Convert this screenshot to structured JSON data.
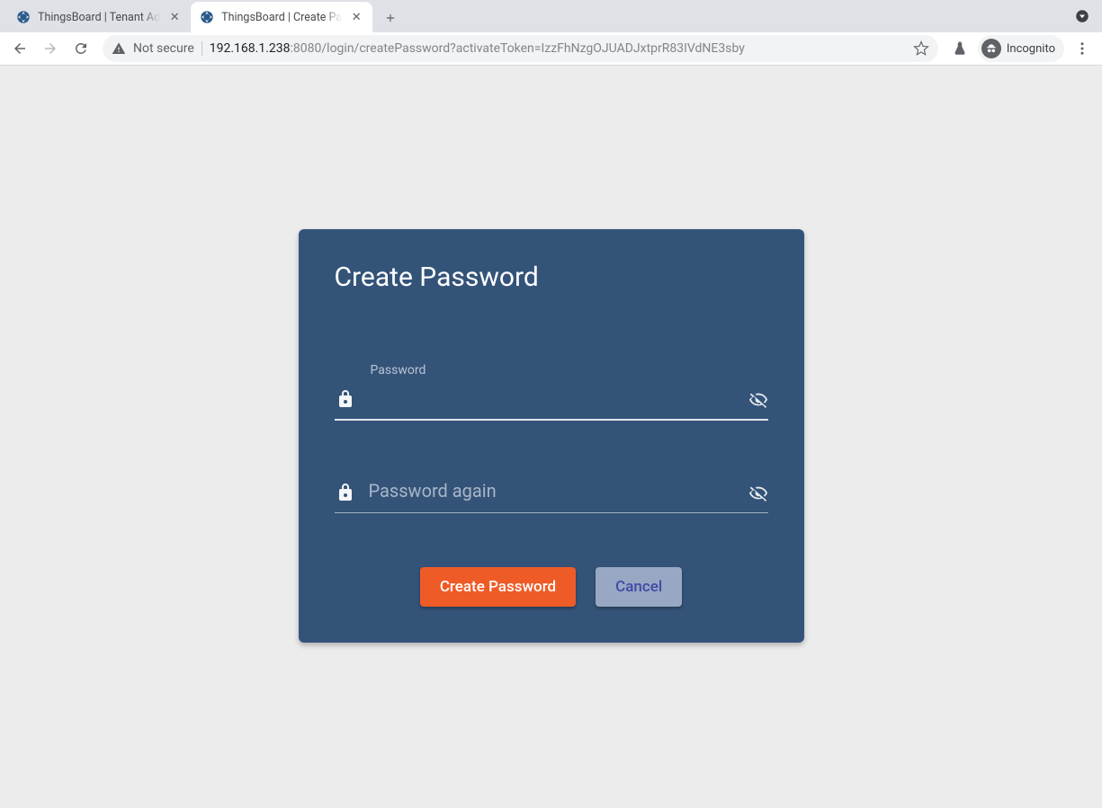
{
  "browser": {
    "tabs": [
      {
        "title": "ThingsBoard | Tenant Ad"
      },
      {
        "title": "ThingsBoard | Create Pa"
      }
    ],
    "not_secure_label": "Not secure",
    "url_host": "192.168.1.238",
    "url_rest": ":8080/login/createPassword?activateToken=IzzFhNzgOJUADJxtprR83IVdNE3sby",
    "incognito_label": "Incognito"
  },
  "card": {
    "title": "Create Password",
    "password_label": "Password",
    "password_value": "",
    "password_again_placeholder": "Password again",
    "password_again_value": "",
    "create_button": "Create Password",
    "cancel_button": "Cancel"
  }
}
